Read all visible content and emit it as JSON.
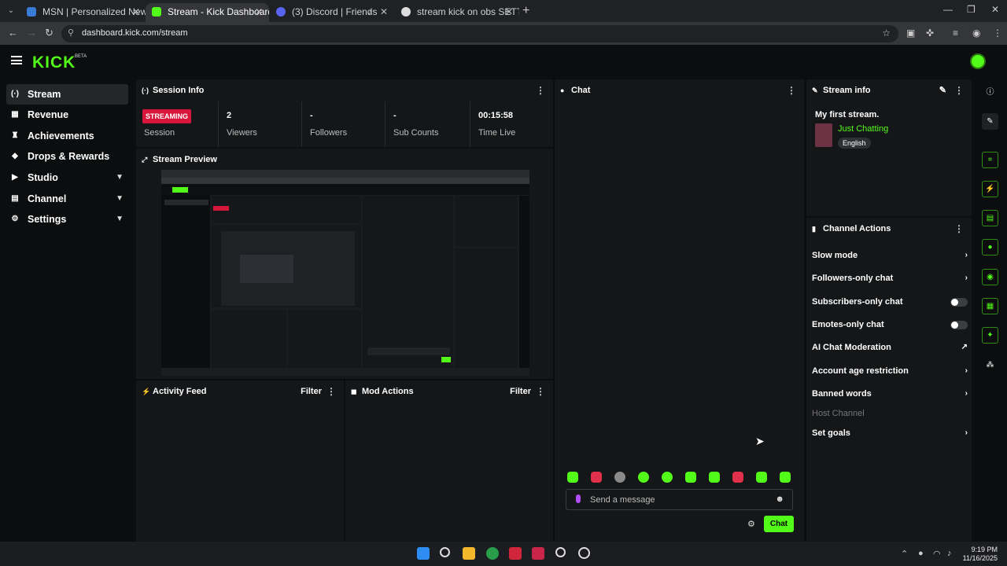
{
  "browser": {
    "tabs": [
      {
        "title": "MSN | Personalized News, Top",
        "active": false
      },
      {
        "title": "Stream - Kick Dashboard",
        "active": true
      },
      {
        "title": "(3) Discord | Friends",
        "active": false
      },
      {
        "title": "stream kick on obs SETTING - G",
        "active": false
      }
    ],
    "url": "dashboard.kick.com/stream"
  },
  "header": {
    "logo": "KICK",
    "beta": "BETA"
  },
  "sidebar": {
    "items": [
      {
        "label": "Stream",
        "icon": "broadcast-icon",
        "glyph": "(·)"
      },
      {
        "label": "Revenue",
        "icon": "money-icon",
        "glyph": "▦"
      },
      {
        "label": "Achievements",
        "icon": "trophy-icon",
        "glyph": "♜"
      },
      {
        "label": "Drops & Rewards",
        "icon": "gift-icon",
        "glyph": "◆"
      },
      {
        "label": "Studio",
        "icon": "studio-icon",
        "glyph": "▶"
      },
      {
        "label": "Channel",
        "icon": "channel-icon",
        "glyph": "▤"
      },
      {
        "label": "Settings",
        "icon": "gear-icon",
        "glyph": "⚙"
      }
    ]
  },
  "session_info": {
    "title": "Session Info",
    "status": "STREAMING",
    "stats": [
      {
        "value": "",
        "label": "Session"
      },
      {
        "value": "2",
        "label": "Viewers"
      },
      {
        "value": "-",
        "label": "Followers"
      },
      {
        "value": "-",
        "label": "Sub Counts"
      },
      {
        "value": "00:15:58",
        "label": "Time Live"
      }
    ]
  },
  "stream_preview": {
    "title": "Stream Preview"
  },
  "activity_feed": {
    "title": "Activity Feed",
    "filter": "Filter"
  },
  "mod_actions": {
    "title": "Mod Actions",
    "filter": "Filter"
  },
  "chat": {
    "title": "Chat",
    "placeholder": "Send a message",
    "send_label": "Chat"
  },
  "stream_info": {
    "title": "Stream info",
    "stream_title": "My first stream.",
    "category": "Just Chatting",
    "language": "English"
  },
  "channel_actions": {
    "title": "Channel Actions",
    "items": [
      {
        "label": "Slow mode",
        "control": "arrow"
      },
      {
        "label": "Followers-only chat",
        "control": "arrow"
      },
      {
        "label": "Subscribers-only chat",
        "control": "toggle"
      },
      {
        "label": "Emotes-only chat",
        "control": "toggle"
      },
      {
        "label": "AI Chat Moderation",
        "control": "external"
      },
      {
        "label": "Account age restriction",
        "control": "arrow"
      },
      {
        "label": "Banned words",
        "control": "arrow"
      },
      {
        "label": "Host Channel",
        "control": "disabled"
      },
      {
        "label": "Set goals",
        "control": "arrow"
      }
    ]
  },
  "taskbar": {
    "time": "9:19 PM",
    "date": "11/16/2025"
  },
  "colors": {
    "accent": "#53fc18",
    "streaming": "#d6163b",
    "panel": "#141618",
    "background": "#0b0d0e"
  }
}
